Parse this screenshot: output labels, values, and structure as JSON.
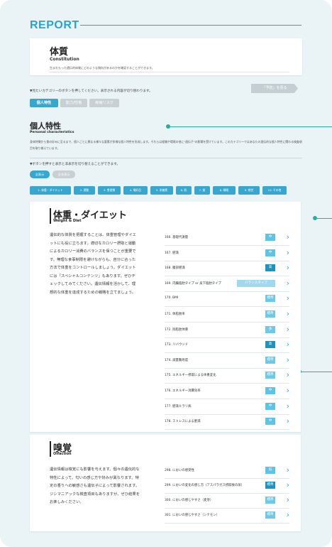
{
  "report_title": "REPORT",
  "constitution": {
    "title": "体質",
    "title_en": "Constitution",
    "description": "生まれもった遺伝的体質にどのような傾向があるのかを確認することができます。"
  },
  "category_instruction": "▼見たいカテゴリーのボタンを押してください。表示される内容が切り替わります。",
  "predict_button": "「予防」を見る",
  "categories": [
    "個人特性",
    "能力/性格",
    "疾病リスク"
  ],
  "section": {
    "title": "個人特性",
    "title_en": "Personal characteristics",
    "description": "身体特徴から食の好みに至るまで、個人ごとに異なる様々な要素が多様な個人特性を形成します。それらは経験や環境の他に\"遺伝子\"の影響を受けています。このカテゴリーではあなたの遺伝的な個人特性に関わる検査項目を取り揃えています。"
  },
  "toggle_instruction": "▼ボタンを押すと表示と非表示を切り替えることができます。",
  "show_buttons": [
    "全表示",
    "全非表示"
  ],
  "chips": [
    "1. 体重・ダイエット",
    "2. 運動",
    "3. 食習慣",
    "4. 嗜好品",
    "5. 栄養素",
    "6. 肌",
    "7. 髪",
    "8. 睡眠",
    "9. 視覚",
    "10. その他"
  ],
  "weight": {
    "title": "体重・ダイエット",
    "title_en": "Weight & Diet",
    "paragraph": [
      "遺伝的な体質を把握することは、体重管理やダイエ",
      "ットにも役に立ちます。適切なカロリー摂取と運動",
      "によるカロリー消費のバランスを保つことが重要で",
      "す。無理な食事制限を避けながらも、自分に合った",
      "方法で体重をコントロールしましょう。ダイエット",
      "には「スペシャルコンテンツ」もあります。ぜひチ",
      "ェックしてみてください。遺伝情報を活かして、理",
      "想的な体重を達成するための戦略を立てましょう。"
    ],
    "items": [
      {
        "label": "166. 基礎代謝量",
        "badge": "中",
        "color": "#5ec3e4"
      },
      {
        "label": "167. 肥満",
        "badge": "中",
        "color": "#5ec3e4"
      },
      {
        "label": "168. 腹部肥満",
        "badge": "高",
        "color": "#1c94be"
      },
      {
        "label": "169. 内臓脂肪タイプ or 皮下脂肪タイプ",
        "badge": "バランスタイプ",
        "color": "#9fd8ef"
      },
      {
        "label": "170. BMI",
        "badge": "標準",
        "color": "#6fc9e6"
      },
      {
        "label": "171. 体脂肪率",
        "badge": "標準",
        "color": "#6fc9e6"
      },
      {
        "label": "172. 除脂肪体重",
        "badge": "多",
        "color": "#6fc9e6"
      },
      {
        "label": "173. リバウンド",
        "badge": "高",
        "color": "#1c94be"
      },
      {
        "label": "174. 減量難易度",
        "badge": "標準",
        "color": "#6fc9e6"
      },
      {
        "label": "175. エネルギー摂取による体重変化",
        "badge": "標準",
        "color": "#6fc9e6"
      },
      {
        "label": "176. エネルギー消費効率",
        "badge": "中",
        "color": "#5ec3e4"
      },
      {
        "label": "177. 肥満ヒラリ病",
        "badge": "中",
        "color": "#5ec3e4"
      },
      {
        "label": "178. ストレスによる肥満",
        "badge": "中",
        "color": "#5ec3e4"
      }
    ]
  },
  "olfaction": {
    "title": "嗅覚",
    "title_en": "Olfaction",
    "paragraph": [
      "遺伝情報は嗅覚にも影響を与えます。個々の遺伝的な",
      "特性によって、匂いの感じ方や好みが異なります。特",
      "定の香りへの敏感さも遺伝子によって影響されます。",
      "ジシマニアックな検査項目もありますが、ぜひ結果を",
      "お楽しみください。"
    ],
    "items": [
      {
        "label": "298. においの感受性",
        "badge": "低",
        "color": "#5ec3e4"
      },
      {
        "label": "299. においの変化の感じ方（アスパラガス摂取後の尿）",
        "badge": "標準",
        "color": "#1c94be"
      },
      {
        "label": "300. においの感じやすさ（麦芽）",
        "badge": "標準",
        "color": "#6fc9e6"
      },
      {
        "label": "301. においの感じやすさ（シナモン）",
        "badge": "標準",
        "color": "#6fc9e6"
      }
    ]
  },
  "icons": {
    "chevron": "chevron-right-icon",
    "connector": "connector-dot-icon"
  },
  "colors": {
    "accent": "#36a7cf",
    "connector": "#24b09a",
    "disabled": "#c8d0d4"
  }
}
